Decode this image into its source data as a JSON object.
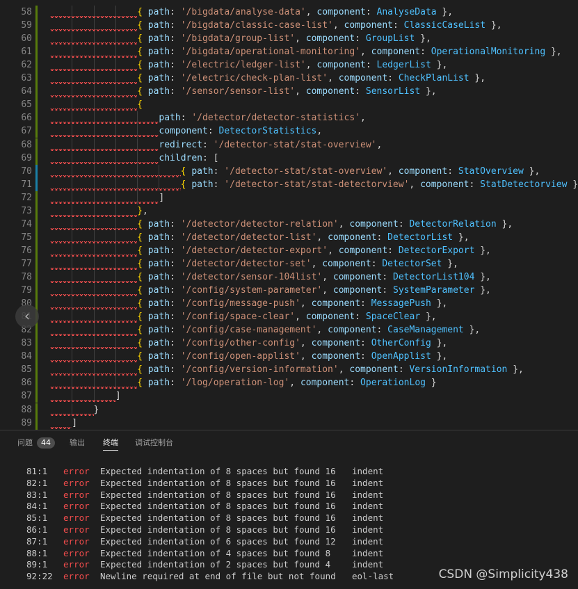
{
  "editor": {
    "lines": [
      {
        "n": "58",
        "tokens": [
          [
            "brace",
            "{ "
          ],
          [
            "key",
            "path"
          ],
          [
            "punc",
            ": "
          ],
          [
            "str",
            "'/bigdata/analyse-data'"
          ],
          [
            "punc",
            ", "
          ],
          [
            "key",
            "component"
          ],
          [
            "punc",
            ": "
          ],
          [
            "comp",
            "AnalyseData"
          ],
          [
            "punc",
            " },"
          ]
        ],
        "indent": 16
      },
      {
        "n": "59",
        "tokens": [
          [
            "brace",
            "{ "
          ],
          [
            "key",
            "path"
          ],
          [
            "punc",
            ": "
          ],
          [
            "str",
            "'/bigdata/classic-case-list'"
          ],
          [
            "punc",
            ", "
          ],
          [
            "key",
            "component"
          ],
          [
            "punc",
            ": "
          ],
          [
            "comp",
            "ClassicCaseList"
          ],
          [
            "punc",
            " },"
          ]
        ],
        "indent": 16
      },
      {
        "n": "60",
        "tokens": [
          [
            "brace",
            "{ "
          ],
          [
            "key",
            "path"
          ],
          [
            "punc",
            ": "
          ],
          [
            "str",
            "'/bigdata/group-list'"
          ],
          [
            "punc",
            ", "
          ],
          [
            "key",
            "component"
          ],
          [
            "punc",
            ": "
          ],
          [
            "comp",
            "GroupList"
          ],
          [
            "punc",
            " },"
          ]
        ],
        "indent": 16
      },
      {
        "n": "61",
        "tokens": [
          [
            "brace",
            "{ "
          ],
          [
            "key",
            "path"
          ],
          [
            "punc",
            ": "
          ],
          [
            "str",
            "'/bigdata/operational-monitoring'"
          ],
          [
            "punc",
            ", "
          ],
          [
            "key",
            "component"
          ],
          [
            "punc",
            ": "
          ],
          [
            "comp",
            "OperationalMonitoring"
          ],
          [
            "punc",
            " },"
          ]
        ],
        "indent": 16
      },
      {
        "n": "62",
        "tokens": [
          [
            "brace",
            "{ "
          ],
          [
            "key",
            "path"
          ],
          [
            "punc",
            ": "
          ],
          [
            "str",
            "'/electric/ledger-list'"
          ],
          [
            "punc",
            ", "
          ],
          [
            "key",
            "component"
          ],
          [
            "punc",
            ": "
          ],
          [
            "comp",
            "LedgerList"
          ],
          [
            "punc",
            " },"
          ]
        ],
        "indent": 16
      },
      {
        "n": "63",
        "tokens": [
          [
            "brace",
            "{ "
          ],
          [
            "key",
            "path"
          ],
          [
            "punc",
            ": "
          ],
          [
            "str",
            "'/electric/check-plan-list'"
          ],
          [
            "punc",
            ", "
          ],
          [
            "key",
            "component"
          ],
          [
            "punc",
            ": "
          ],
          [
            "comp",
            "CheckPlanList"
          ],
          [
            "punc",
            " },"
          ]
        ],
        "indent": 16
      },
      {
        "n": "64",
        "tokens": [
          [
            "brace",
            "{ "
          ],
          [
            "key",
            "path"
          ],
          [
            "punc",
            ": "
          ],
          [
            "str",
            "'/sensor/sensor-list'"
          ],
          [
            "punc",
            ", "
          ],
          [
            "key",
            "component"
          ],
          [
            "punc",
            ": "
          ],
          [
            "comp",
            "SensorList"
          ],
          [
            "punc",
            " },"
          ]
        ],
        "indent": 16
      },
      {
        "n": "65",
        "tokens": [
          [
            "brace",
            "{"
          ]
        ],
        "indent": 16
      },
      {
        "n": "66",
        "tokens": [
          [
            "key",
            "path"
          ],
          [
            "punc",
            ": "
          ],
          [
            "str",
            "'/detector/detector-statistics'"
          ],
          [
            "punc",
            ","
          ]
        ],
        "indent": 20
      },
      {
        "n": "67",
        "tokens": [
          [
            "key",
            "component"
          ],
          [
            "punc",
            ": "
          ],
          [
            "comp",
            "DetectorStatistics"
          ],
          [
            "punc",
            ","
          ]
        ],
        "indent": 20
      },
      {
        "n": "68",
        "tokens": [
          [
            "key",
            "redirect"
          ],
          [
            "punc",
            ": "
          ],
          [
            "str",
            "'/detector-stat/stat-overview'"
          ],
          [
            "punc",
            ","
          ]
        ],
        "indent": 20
      },
      {
        "n": "69",
        "tokens": [
          [
            "key",
            "children"
          ],
          [
            "punc",
            ": ["
          ]
        ],
        "indent": 20
      },
      {
        "n": "70",
        "tokens": [
          [
            "brace",
            "{ "
          ],
          [
            "key",
            "path"
          ],
          [
            "punc",
            ": "
          ],
          [
            "str",
            "'/detector-stat/stat-overview'"
          ],
          [
            "punc",
            ", "
          ],
          [
            "key",
            "component"
          ],
          [
            "punc",
            ": "
          ],
          [
            "comp",
            "StatOverview"
          ],
          [
            "punc",
            " },"
          ]
        ],
        "indent": 24
      },
      {
        "n": "71",
        "tokens": [
          [
            "brace",
            "{ "
          ],
          [
            "key",
            "path"
          ],
          [
            "punc",
            ": "
          ],
          [
            "str",
            "'/detector-stat/stat-detectorview'"
          ],
          [
            "punc",
            ", "
          ],
          [
            "key",
            "component"
          ],
          [
            "punc",
            ": "
          ],
          [
            "comp",
            "StatDetectorview"
          ],
          [
            "punc",
            " }"
          ]
        ],
        "indent": 24
      },
      {
        "n": "72",
        "tokens": [
          [
            "punc",
            "]"
          ]
        ],
        "indent": 20
      },
      {
        "n": "73",
        "tokens": [
          [
            "brace",
            "}"
          ],
          [
            "punc",
            ","
          ]
        ],
        "indent": 16
      },
      {
        "n": "74",
        "tokens": [
          [
            "brace",
            "{ "
          ],
          [
            "key",
            "path"
          ],
          [
            "punc",
            ": "
          ],
          [
            "str",
            "'/detector/detector-relation'"
          ],
          [
            "punc",
            ", "
          ],
          [
            "key",
            "component"
          ],
          [
            "punc",
            ": "
          ],
          [
            "comp",
            "DetectorRelation"
          ],
          [
            "punc",
            " },"
          ]
        ],
        "indent": 16
      },
      {
        "n": "75",
        "tokens": [
          [
            "brace",
            "{ "
          ],
          [
            "key",
            "path"
          ],
          [
            "punc",
            ": "
          ],
          [
            "str",
            "'/detector/detector-list'"
          ],
          [
            "punc",
            ", "
          ],
          [
            "key",
            "component"
          ],
          [
            "punc",
            ": "
          ],
          [
            "comp",
            "DetectorList"
          ],
          [
            "punc",
            " },"
          ]
        ],
        "indent": 16
      },
      {
        "n": "76",
        "tokens": [
          [
            "brace",
            "{ "
          ],
          [
            "key",
            "path"
          ],
          [
            "punc",
            ": "
          ],
          [
            "str",
            "'/detector/detector-export'"
          ],
          [
            "punc",
            ", "
          ],
          [
            "key",
            "component"
          ],
          [
            "punc",
            ": "
          ],
          [
            "comp",
            "DetectorExport"
          ],
          [
            "punc",
            " },"
          ]
        ],
        "indent": 16
      },
      {
        "n": "77",
        "tokens": [
          [
            "brace",
            "{ "
          ],
          [
            "key",
            "path"
          ],
          [
            "punc",
            ": "
          ],
          [
            "str",
            "'/detector/detector-set'"
          ],
          [
            "punc",
            ", "
          ],
          [
            "key",
            "component"
          ],
          [
            "punc",
            ": "
          ],
          [
            "comp",
            "DetectorSet"
          ],
          [
            "punc",
            " },"
          ]
        ],
        "indent": 16
      },
      {
        "n": "78",
        "tokens": [
          [
            "brace",
            "{ "
          ],
          [
            "key",
            "path"
          ],
          [
            "punc",
            ": "
          ],
          [
            "str",
            "'/detector/sensor-104list'"
          ],
          [
            "punc",
            ", "
          ],
          [
            "key",
            "component"
          ],
          [
            "punc",
            ": "
          ],
          [
            "comp",
            "DetectorList104"
          ],
          [
            "punc",
            " },"
          ]
        ],
        "indent": 16
      },
      {
        "n": "79",
        "tokens": [
          [
            "brace",
            "{ "
          ],
          [
            "key",
            "path"
          ],
          [
            "punc",
            ": "
          ],
          [
            "str",
            "'/config/system-parameter'"
          ],
          [
            "punc",
            ", "
          ],
          [
            "key",
            "component"
          ],
          [
            "punc",
            ": "
          ],
          [
            "comp",
            "SystemParameter"
          ],
          [
            "punc",
            " },"
          ]
        ],
        "indent": 16
      },
      {
        "n": "80",
        "tokens": [
          [
            "brace",
            "{ "
          ],
          [
            "key",
            "path"
          ],
          [
            "punc",
            ": "
          ],
          [
            "str",
            "'/config/message-push'"
          ],
          [
            "punc",
            ", "
          ],
          [
            "key",
            "component"
          ],
          [
            "punc",
            ": "
          ],
          [
            "comp",
            "MessagePush"
          ],
          [
            "punc",
            " },"
          ]
        ],
        "indent": 16
      },
      {
        "n": "81",
        "tokens": [
          [
            "brace",
            "{ "
          ],
          [
            "key",
            "path"
          ],
          [
            "punc",
            ": "
          ],
          [
            "str",
            "'/config/space-clear'"
          ],
          [
            "punc",
            ", "
          ],
          [
            "key",
            "component"
          ],
          [
            "punc",
            ": "
          ],
          [
            "comp",
            "SpaceClear"
          ],
          [
            "punc",
            " },"
          ]
        ],
        "indent": 16
      },
      {
        "n": "82",
        "tokens": [
          [
            "brace",
            "{ "
          ],
          [
            "key",
            "path"
          ],
          [
            "punc",
            ": "
          ],
          [
            "str",
            "'/config/case-management'"
          ],
          [
            "punc",
            ", "
          ],
          [
            "key",
            "component"
          ],
          [
            "punc",
            ": "
          ],
          [
            "comp",
            "CaseManagement"
          ],
          [
            "punc",
            " },"
          ]
        ],
        "indent": 16
      },
      {
        "n": "83",
        "tokens": [
          [
            "brace",
            "{ "
          ],
          [
            "key",
            "path"
          ],
          [
            "punc",
            ": "
          ],
          [
            "str",
            "'/config/other-config'"
          ],
          [
            "punc",
            ", "
          ],
          [
            "key",
            "component"
          ],
          [
            "punc",
            ": "
          ],
          [
            "comp",
            "OtherConfig"
          ],
          [
            "punc",
            " },"
          ]
        ],
        "indent": 16
      },
      {
        "n": "84",
        "tokens": [
          [
            "brace",
            "{ "
          ],
          [
            "key",
            "path"
          ],
          [
            "punc",
            ": "
          ],
          [
            "str",
            "'/config/open-applist'"
          ],
          [
            "punc",
            ", "
          ],
          [
            "key",
            "component"
          ],
          [
            "punc",
            ": "
          ],
          [
            "comp",
            "OpenApplist"
          ],
          [
            "punc",
            " },"
          ]
        ],
        "indent": 16
      },
      {
        "n": "85",
        "tokens": [
          [
            "brace",
            "{ "
          ],
          [
            "key",
            "path"
          ],
          [
            "punc",
            ": "
          ],
          [
            "str",
            "'/config/version-information'"
          ],
          [
            "punc",
            ", "
          ],
          [
            "key",
            "component"
          ],
          [
            "punc",
            ": "
          ],
          [
            "comp",
            "VersionInformation"
          ],
          [
            "punc",
            " },"
          ]
        ],
        "indent": 16
      },
      {
        "n": "86",
        "tokens": [
          [
            "brace",
            "{ "
          ],
          [
            "key",
            "path"
          ],
          [
            "punc",
            ": "
          ],
          [
            "str",
            "'/log/operation-log'"
          ],
          [
            "punc",
            ", "
          ],
          [
            "key",
            "component"
          ],
          [
            "punc",
            ": "
          ],
          [
            "comp",
            "OperationLog"
          ],
          [
            "punc",
            " }"
          ]
        ],
        "indent": 16
      },
      {
        "n": "87",
        "tokens": [
          [
            "punc",
            "]"
          ]
        ],
        "indent": 12
      },
      {
        "n": "88",
        "tokens": [
          [
            "punc",
            "}"
          ]
        ],
        "indent": 8
      },
      {
        "n": "89",
        "tokens": [
          [
            "punc",
            "]"
          ]
        ],
        "indent": 4
      }
    ]
  },
  "panel": {
    "tabs": [
      {
        "label": "问题",
        "badge": "44",
        "active": false
      },
      {
        "label": "输出",
        "active": false
      },
      {
        "label": "终端",
        "active": true
      },
      {
        "label": "调试控制台",
        "active": false
      }
    ],
    "terminal_rows": [
      {
        "loc": "81:1",
        "sev": "error",
        "msg": "Expected indentation of 8 spaces but found 16",
        "rule": "indent"
      },
      {
        "loc": "82:1",
        "sev": "error",
        "msg": "Expected indentation of 8 spaces but found 16",
        "rule": "indent"
      },
      {
        "loc": "83:1",
        "sev": "error",
        "msg": "Expected indentation of 8 spaces but found 16",
        "rule": "indent"
      },
      {
        "loc": "84:1",
        "sev": "error",
        "msg": "Expected indentation of 8 spaces but found 16",
        "rule": "indent"
      },
      {
        "loc": "85:1",
        "sev": "error",
        "msg": "Expected indentation of 8 spaces but found 16",
        "rule": "indent"
      },
      {
        "loc": "86:1",
        "sev": "error",
        "msg": "Expected indentation of 8 spaces but found 16",
        "rule": "indent"
      },
      {
        "loc": "87:1",
        "sev": "error",
        "msg": "Expected indentation of 6 spaces but found 12",
        "rule": "indent"
      },
      {
        "loc": "88:1",
        "sev": "error",
        "msg": "Expected indentation of 4 spaces but found 8",
        "rule": "indent"
      },
      {
        "loc": "89:1",
        "sev": "error",
        "msg": "Expected indentation of 2 spaces but found 4",
        "rule": "indent"
      },
      {
        "loc": "92:22",
        "sev": "error",
        "msg": "Newline required at end of file but not found",
        "rule": "eol-last"
      }
    ]
  },
  "nav_arrow": {
    "glyph": "‹",
    "icon": "chevron-left-icon"
  },
  "watermark": "CSDN @Simplicity438",
  "colors": {
    "background": "#1e1e1e",
    "error": "#f14c4c",
    "string": "#ce9178",
    "key": "#9cdcfe",
    "component": "#4fc1ff",
    "brace": "#ffd700",
    "modified_gutter": "#1b81a8",
    "added_gutter": "#587c0c"
  }
}
